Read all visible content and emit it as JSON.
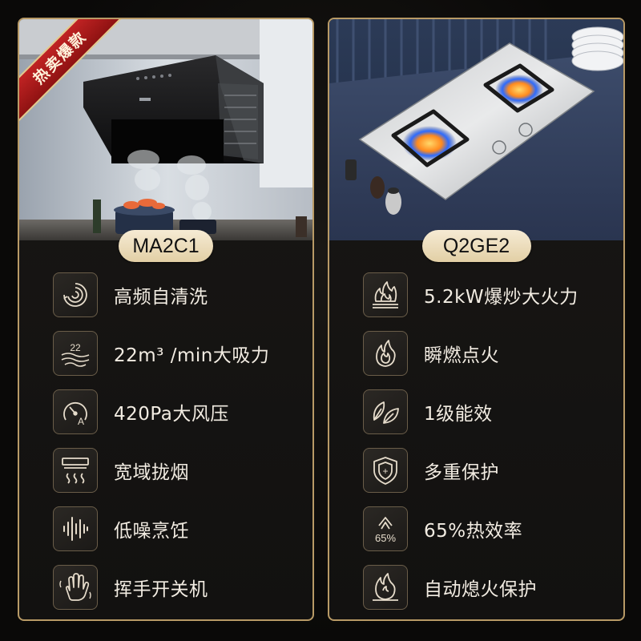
{
  "badge": {
    "label": "热卖爆款"
  },
  "products": [
    {
      "model": "MA2C1",
      "image": "range-hood-photo",
      "features": [
        {
          "icon": "self-clean-swirl-icon",
          "label": "高频自清洗"
        },
        {
          "icon": "suction-22-icon",
          "icon_text": "22",
          "label": "22m³ /min大吸力"
        },
        {
          "icon": "pressure-gauge-icon",
          "icon_text": "A",
          "label": "420Pa大风压"
        },
        {
          "icon": "wide-smoke-capture-icon",
          "label": "宽域拢烟"
        },
        {
          "icon": "sound-wave-icon",
          "label": "低噪烹饪"
        },
        {
          "icon": "hand-wave-icon",
          "label": "挥手开关机"
        }
      ]
    },
    {
      "model": "Q2GE2",
      "image": "gas-stove-photo",
      "features": [
        {
          "icon": "big-flame-icon",
          "label": "5.2kW爆炒大火力"
        },
        {
          "icon": "instant-ignition-flame-icon",
          "label": "瞬燃点火"
        },
        {
          "icon": "leaf-efficiency-icon",
          "label": "1级能效"
        },
        {
          "icon": "shield-plus-icon",
          "icon_text": "+",
          "label": "多重保护"
        },
        {
          "icon": "efficiency-65-icon",
          "icon_text": "65%",
          "label": "65%热效率"
        },
        {
          "icon": "flame-out-protection-icon",
          "label": "自动熄火保护"
        }
      ]
    }
  ],
  "colors": {
    "gold_border": "#b89a66",
    "pill_bg": "#f0e2c2",
    "badge_red": "#b01a1a",
    "icon_stroke": "#e6dccb"
  }
}
